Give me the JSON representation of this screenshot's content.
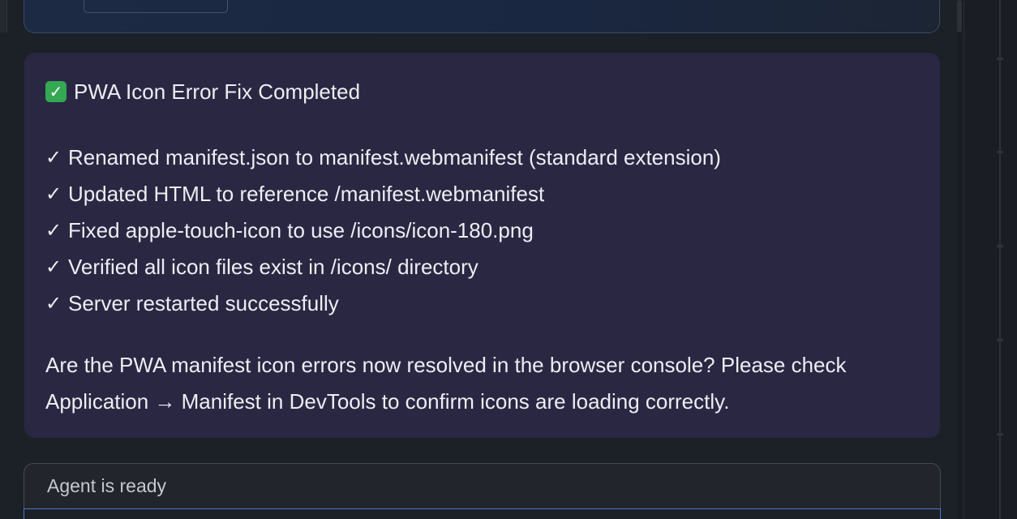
{
  "message": {
    "title": "PWA Icon Error Fix Completed",
    "title_icon": "check-mark-button-icon",
    "checklist": [
      "Renamed manifest.json to manifest.webmanifest (standard extension)",
      "Updated HTML to reference /manifest.webmanifest",
      "Fixed apple-touch-icon to use /icons/icon-180.png",
      "Verified all icon files exist in /icons/ directory",
      "Server restarted successfully"
    ],
    "check_glyph": "✓",
    "question": "Are the PWA manifest icon errors now resolved in the browser console? Please check Application → Manifest in DevTools to confirm icons are loading correctly."
  },
  "status": {
    "text": "Agent is ready"
  },
  "colors": {
    "message_bg": "#2a2743",
    "page_bg": "#1c2027",
    "input_focus": "#4a78c9",
    "check_green": "#34a853"
  }
}
